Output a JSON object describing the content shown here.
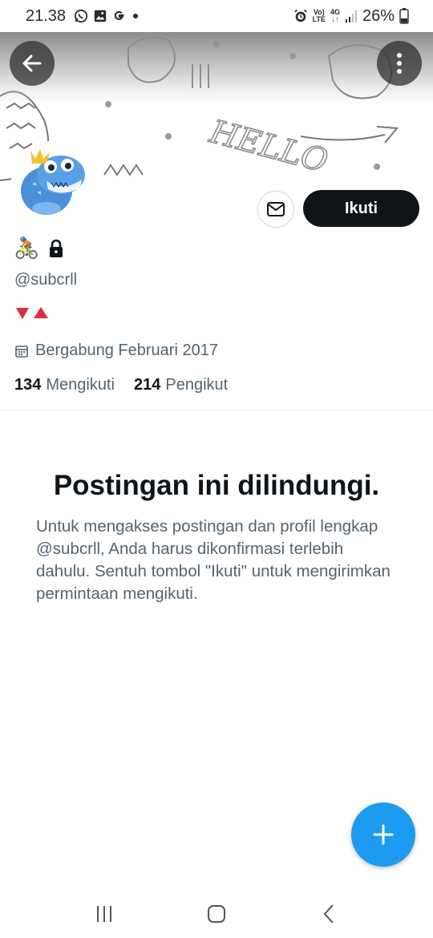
{
  "status_bar": {
    "time": "21.38",
    "battery": "26%",
    "network_top": "Vo)",
    "network_bottom": "LTE",
    "signal_type_top": "4G",
    "signal_type_bottom": "↓↑",
    "icons": [
      "whatsapp-icon",
      "gallery-icon",
      "google-icon",
      "dot-icon",
      "alarm-icon",
      "signal-icon",
      "battery-icon"
    ]
  },
  "banner": {
    "text": "HELLO"
  },
  "header": {
    "back_icon": "arrow-left-icon",
    "more_icon": "more-vertical-icon"
  },
  "profile": {
    "name_emoji": "🚴🏽",
    "lock_icon": "🔒",
    "handle": "@subcrll",
    "bio": "🔻🔺",
    "joined": "Bergabung Februari 2017",
    "following_count": "134",
    "following_label": "Mengikuti",
    "followers_count": "214",
    "followers_label": "Pengikut"
  },
  "actions": {
    "message_icon": "mail-icon",
    "follow_label": "Ikuti"
  },
  "protected": {
    "title": "Postingan ini dilindungi.",
    "body": "Untuk mengakses postingan dan profil lengkap @subcrll, Anda harus dikonfirmasi terlebih dahulu. Sentuh tombol \"Ikuti\" untuk mengirimkan permintaan mengikuti."
  },
  "fab": {
    "icon": "plus-icon"
  },
  "nav": {
    "items": [
      "recent-apps-icon",
      "home-icon",
      "back-icon"
    ]
  },
  "colors": {
    "accent": "#1d9bf0",
    "text_primary": "#0f1419",
    "text_secondary": "#536471",
    "follow_button": "#0f1419",
    "divider": "#eff3f4"
  }
}
